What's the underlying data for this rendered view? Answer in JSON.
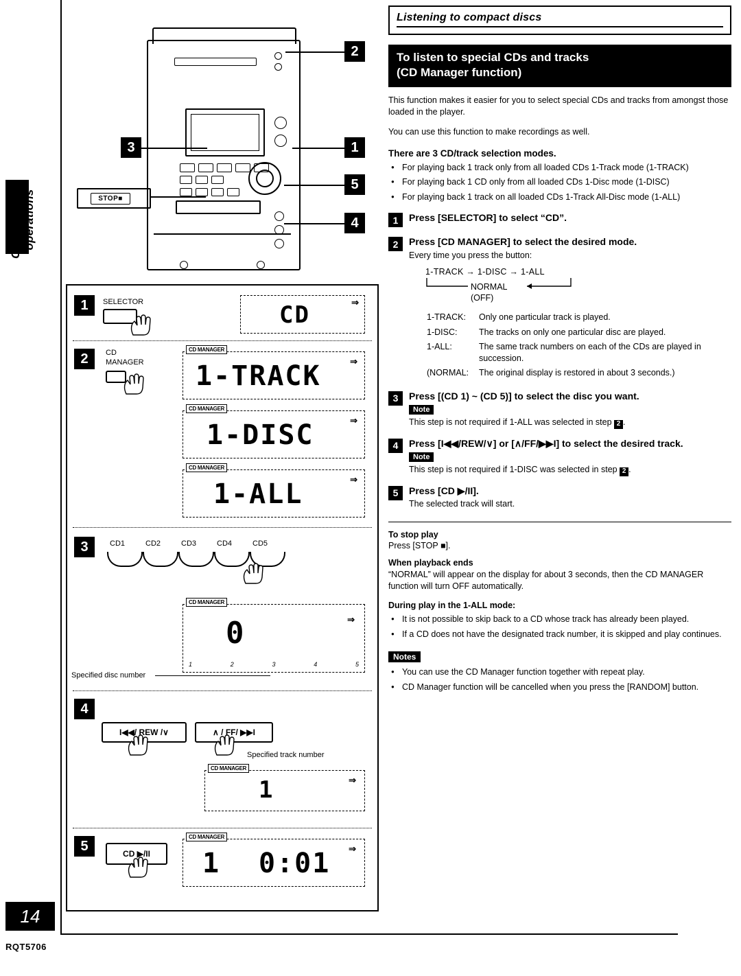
{
  "page": {
    "number": "14",
    "code": "RQT5706",
    "side_label": "Compact disc operations"
  },
  "right": {
    "section_title": "Listening to compact discs",
    "black_heading_line1": "To listen to special CDs and tracks",
    "black_heading_line2": "(CD Manager function)",
    "intro1": "This function makes it easier for you to select special CDs and tracks from amongst those loaded in the player.",
    "intro2": "You can use this function to make recordings as well.",
    "modes_heading": "There are 3 CD/track selection modes.",
    "modes": [
      "For playing back 1 track only from all loaded CDs 1-Track mode (1-TRACK)",
      "For playing back 1 CD only from all loaded CDs 1-Disc mode (1-DISC)",
      "For playing back 1 track on all loaded CDs 1-Track All-Disc mode (1-ALL)"
    ],
    "steps": [
      {
        "num": "1",
        "heading": "Press [SELECTOR] to select “CD”.",
        "sub": "",
        "note": ""
      },
      {
        "num": "2",
        "heading": "Press [CD MANAGER] to select the desired mode.",
        "sub": "Every time you press the button:",
        "note": ""
      },
      {
        "num": "3",
        "heading": "Press [(CD 1) ~ (CD 5)] to select the disc you want.",
        "sub": "This step is not required if 1-ALL was selected in step",
        "sub_after": ".",
        "note": "Note",
        "note_ref": "2"
      },
      {
        "num": "4",
        "heading": "Press [I◀◀/REW/∨] or [∧/FF/▶▶I] to select the desired track.",
        "sub": "This step is not required if 1-DISC was selected in step",
        "sub_after": ".",
        "note": "Note",
        "note_ref": "2"
      },
      {
        "num": "5",
        "heading": "Press [CD ▶/II].",
        "sub": "The selected track will start.",
        "note": ""
      }
    ],
    "cycle": {
      "line1": "1-TRACK → 1-DISC → 1-ALL",
      "normal": "NORMAL",
      "off": "(OFF)"
    },
    "definitions": [
      {
        "key": "1-TRACK:",
        "value": "Only one particular track is played."
      },
      {
        "key": "1-DISC:",
        "value": "The tracks on only one particular disc are played."
      },
      {
        "key": "1-ALL:",
        "value": "The same track numbers on each of the CDs are played in succession."
      },
      {
        "key": "(NORMAL:",
        "value": "The original display is restored in about 3 seconds.)"
      }
    ],
    "stop": {
      "heading": "To stop play",
      "text": "Press [STOP ■]."
    },
    "playback_end": {
      "heading": "When playback ends",
      "text": "“NORMAL” will appear on the display for about 3 seconds, then the CD MANAGER function will turn OFF automatically."
    },
    "during_play": {
      "heading": "During play in the 1-ALL mode:",
      "items": [
        "It is not possible to skip back to a CD whose track has already been played.",
        "If a CD does not have the designated track number, it is skipped and play continues."
      ]
    },
    "notes": {
      "badge": "Notes",
      "items": [
        "You can use the CD Manager function together with repeat play.",
        "CD Manager function will be cancelled when you press the [RANDOM] button."
      ]
    }
  },
  "illustration": {
    "callouts": [
      "1",
      "2",
      "3",
      "4",
      "5"
    ],
    "stop_button_label": "STOP■",
    "step1": {
      "num": "1",
      "button_label": "SELECTOR",
      "display": "CD"
    },
    "step2": {
      "num": "2",
      "button_label_line1": "CD",
      "button_label_line2": "MANAGER",
      "badge": "CD MANAGER",
      "display1": "1-TRACK",
      "display2": "1-DISC",
      "display3": "1-ALL"
    },
    "step3": {
      "num": "3",
      "cd_buttons": [
        "CD1",
        "CD2",
        "CD3",
        "CD4",
        "CD5"
      ],
      "badge": "CD MANAGER",
      "display": "0",
      "caption": "Specified disc number",
      "disc_ticks": [
        "1",
        "2",
        "3",
        "4",
        "5"
      ]
    },
    "step4": {
      "num": "4",
      "button_left": "I◀◀/ REW /∨",
      "button_right": "∧ / FF/ ▶▶I",
      "caption": "Specified track number",
      "badge": "CD MANAGER",
      "display": "1"
    },
    "step5": {
      "num": "5",
      "button_label": "CD ▶/II",
      "badge": "CD MANAGER",
      "display_track": "1",
      "display_time": "0:01"
    }
  }
}
